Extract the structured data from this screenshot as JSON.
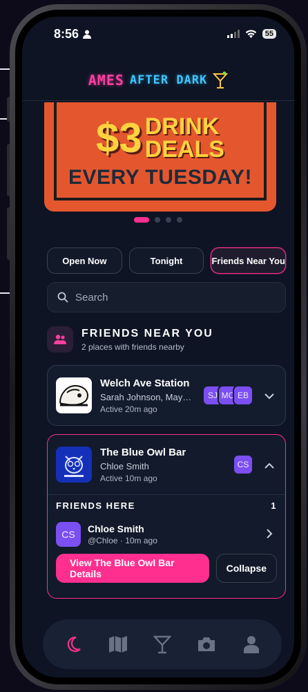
{
  "status": {
    "time": "8:56",
    "battery": "55"
  },
  "app": {
    "logo_part1": "AMES",
    "logo_part2": "AFTER DARK"
  },
  "banner": {
    "price": "$3",
    "word1": "DRINK",
    "word2": "DEALS",
    "sub": "EVERY TUESDAY!",
    "slide_count": 4,
    "active_slide": 1
  },
  "filters": {
    "open_now": "Open Now",
    "tonight": "Tonight",
    "friends_near_you": "Friends Near You"
  },
  "search": {
    "placeholder": "Search"
  },
  "section": {
    "title": "FRIENDS NEAR YOU",
    "subtitle": "2 places with friends nearby"
  },
  "venues": [
    {
      "name": "Welch Ave Station",
      "friends": "Sarah Johnson, Maya Ch...",
      "active": "Active 20m ago",
      "avatars": [
        "SJ",
        "MC",
        "EB"
      ]
    },
    {
      "name": "The Blue Owl Bar",
      "friends": "Chloe Smith",
      "active": "Active 10m ago",
      "avatars": [
        "CS"
      ],
      "friends_here_label": "FRIENDS HERE",
      "friends_here_count": "1",
      "friend": {
        "initials": "CS",
        "name": "Chloe Smith",
        "handle": "@Chloe · 10m ago"
      },
      "details_button": "View The Blue Owl Bar Details",
      "collapse_button": "Collapse"
    }
  ],
  "tabs": [
    "moon-icon",
    "map-icon",
    "cocktail-icon",
    "camera-icon",
    "profile-icon"
  ],
  "colors": {
    "accent": "#ff2f8f",
    "avatar": "#7b4ff2",
    "background": "#0e1424"
  }
}
